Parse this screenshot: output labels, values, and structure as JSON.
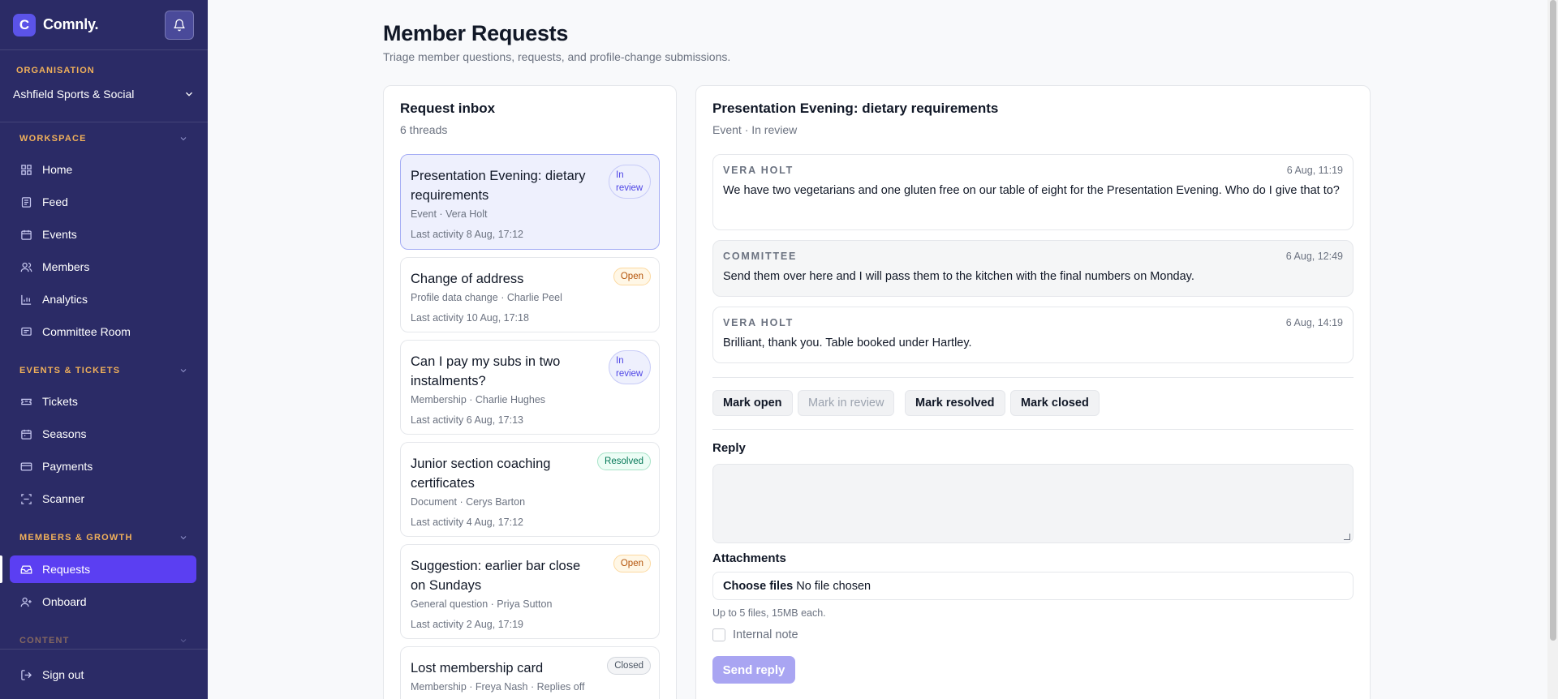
{
  "brand": {
    "logo_letter": "C",
    "name": "Comnly."
  },
  "organisation": {
    "label": "ORGANISATION",
    "selected": "Ashfield Sports & Social"
  },
  "sidebar": {
    "sections": [
      {
        "title": "WORKSPACE",
        "items": [
          {
            "label": "Home",
            "icon": "home-icon"
          },
          {
            "label": "Feed",
            "icon": "feed-icon"
          },
          {
            "label": "Events",
            "icon": "calendar-icon"
          },
          {
            "label": "Members",
            "icon": "users-icon"
          },
          {
            "label": "Analytics",
            "icon": "chart-icon"
          },
          {
            "label": "Committee Room",
            "icon": "chat-icon"
          }
        ]
      },
      {
        "title": "EVENTS & TICKETS",
        "items": [
          {
            "label": "Tickets",
            "icon": "ticket-icon"
          },
          {
            "label": "Seasons",
            "icon": "calendar-icon"
          },
          {
            "label": "Payments",
            "icon": "card-icon"
          },
          {
            "label": "Scanner",
            "icon": "scan-icon"
          }
        ]
      },
      {
        "title": "MEMBERS & GROWTH",
        "items": [
          {
            "label": "Requests",
            "icon": "inbox-icon",
            "active": true
          },
          {
            "label": "Onboard",
            "icon": "user-plus-icon"
          }
        ]
      },
      {
        "title": "CONTENT",
        "items": []
      }
    ],
    "signout": "Sign out"
  },
  "page": {
    "title": "Member Requests",
    "subtitle": "Triage member questions, requests, and profile-change submissions."
  },
  "inbox": {
    "title": "Request inbox",
    "count": "6 threads",
    "threads": [
      {
        "title": "Presentation Evening: dietary requirements",
        "meta": "Event · Vera Holt",
        "activity": "Last activity 8 Aug, 17:12",
        "status": "In review",
        "selected": true
      },
      {
        "title": "Change of address",
        "meta": "Profile data change · Charlie Peel",
        "activity": "Last activity 10 Aug, 17:18",
        "status": "Open"
      },
      {
        "title": "Can I pay my subs in two instalments?",
        "meta": "Membership · Charlie Hughes",
        "activity": "Last activity 6 Aug, 17:13",
        "status": "In review"
      },
      {
        "title": "Junior section coaching certificates",
        "meta": "Document · Cerys Barton",
        "activity": "Last activity 4 Aug, 17:12",
        "status": "Resolved"
      },
      {
        "title": "Suggestion: earlier bar close on Sundays",
        "meta": "General question · Priya Sutton",
        "activity": "Last activity 2 Aug, 17:19",
        "status": "Open"
      },
      {
        "title": "Lost membership card",
        "meta": "Membership · Freya Nash · Replies off",
        "activity": "",
        "status": "Closed"
      }
    ]
  },
  "detail": {
    "title": "Presentation Evening: dietary requirements",
    "subtitle": "Event · In review",
    "messages": [
      {
        "author": "VERA HOLT",
        "time": "6 Aug, 11:19",
        "body": "We have two vegetarians and one gluten free on our table of eight for the Presentation Evening. Who do I give that to?"
      },
      {
        "author": "COMMITTEE",
        "time": "6 Aug, 12:49",
        "body": "Send them over here and I will pass them to the kitchen with the final numbers on Monday."
      },
      {
        "author": "VERA HOLT",
        "time": "6 Aug, 14:19",
        "body": "Brilliant, thank you. Table booked under Hartley."
      }
    ],
    "actions": {
      "open": "Mark open",
      "review": "Mark in review",
      "resolved": "Mark resolved",
      "closed": "Mark closed"
    },
    "reply_label": "Reply",
    "reply_value": "",
    "attachments_label": "Attachments",
    "file_button": "Choose files",
    "file_status": "No file chosen",
    "file_hint": "Up to 5 files, 15MB each.",
    "internal_note": "Internal note",
    "send": "Send reply"
  },
  "colors": {
    "sidebar": "#2b2b66",
    "accent": "#5b3ff2",
    "section_heading": "#f0b05a"
  }
}
